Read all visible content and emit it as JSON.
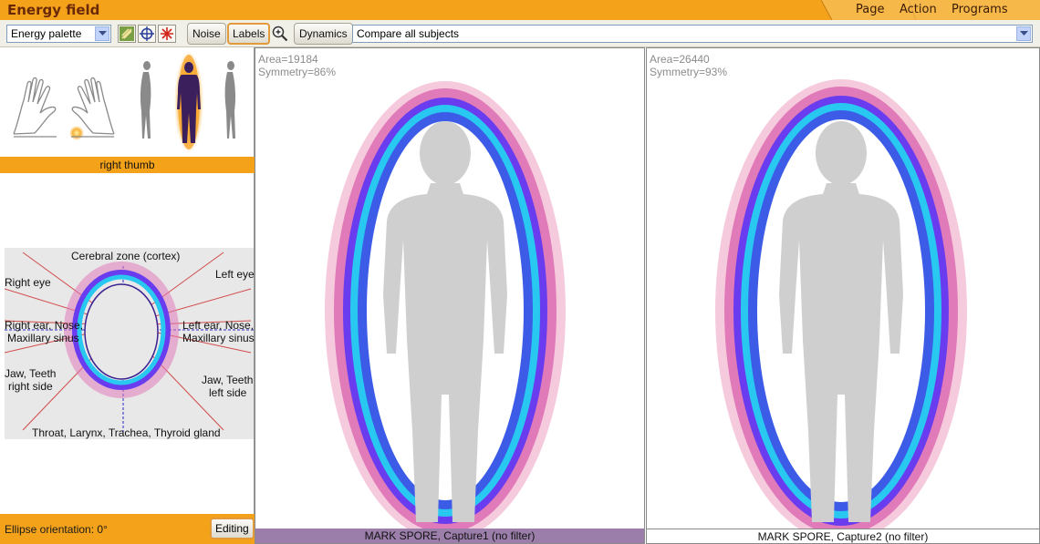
{
  "app": {
    "title": "Energy field"
  },
  "menu": {
    "items": [
      "Page",
      "Action",
      "Programs"
    ]
  },
  "toolbar": {
    "palette_value": "Energy palette",
    "noise_label": "Noise",
    "labels_label": "Labels",
    "dynamics_label": "Dynamics",
    "compare_value": "Compare all subjects"
  },
  "left_panel": {
    "selected_label": "right thumb",
    "zones": {
      "cerebral": "Cerebral zone (cortex)",
      "left_eye": "Left eye",
      "right_eye": "Right eye",
      "right_ear_1": "Right ear, Nose,",
      "right_ear_2": "Maxillary sinus",
      "left_ear_1": "Left ear, Nose,",
      "left_ear_2": "Maxillary sinus",
      "jaw_right_1": "Jaw, Teeth",
      "jaw_right_2": "right side",
      "jaw_left_1": "Jaw, Teeth",
      "jaw_left_2": "left side",
      "throat": "Throat, Larynx, Trachea, Thyroid gland"
    },
    "ellipse_orientation": "Ellipse orientation: 0°",
    "editing_label": "Editing"
  },
  "captures": [
    {
      "area": "Area=19184",
      "symmetry": "Symmetry=86%",
      "caption": "MARK SPORE, Capture1 (no filter)"
    },
    {
      "area": "Area=26440",
      "symmetry": "Symmetry=93%",
      "caption": "MARK SPORE, Capture2 (no filter)"
    }
  ],
  "colors": {
    "accent": "#f5a21b",
    "aura_outer": "#e07ab8",
    "aura_mid": "#6a3cf0",
    "aura_inner": "#28c8f0",
    "silhouette": "#cfcfcf"
  }
}
